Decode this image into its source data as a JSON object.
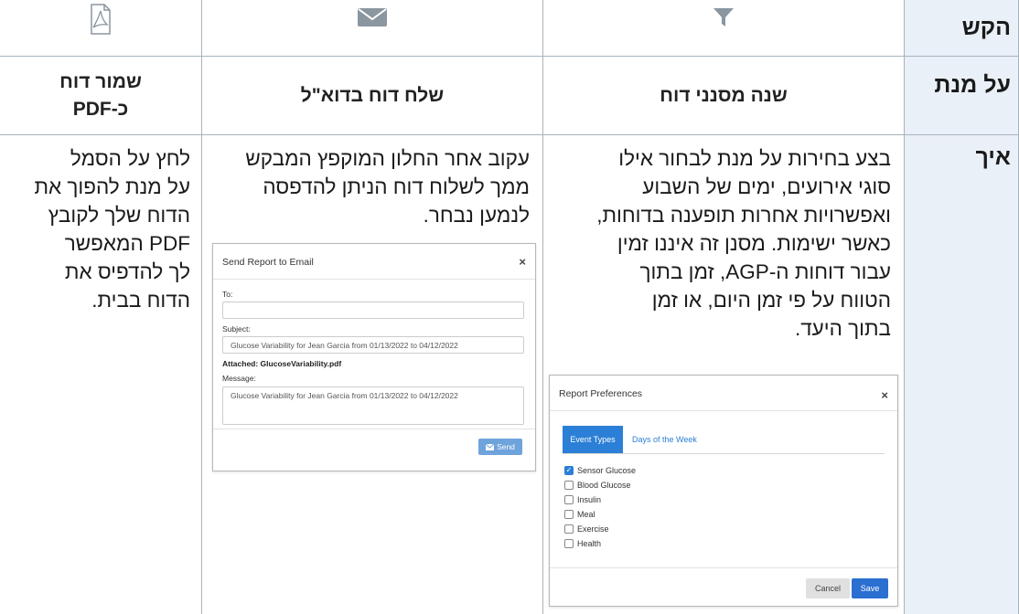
{
  "row_headers": {
    "request": "הקש",
    "purpose": "על מנת",
    "how": "איך"
  },
  "icons": {
    "filter": "filter-icon",
    "email": "envelope-icon",
    "pdf": "pdf-icon"
  },
  "purposes": {
    "filter": "שנה מסנני דוח",
    "email": "שלח דוח בדוא\"ל",
    "pdf_line1": "שמור דוח",
    "pdf_line2": "כ-PDF"
  },
  "how": {
    "filter_lines": [
      "בצע בחירות על מנת לבחור אילו",
      "סוגי אירועים, ימים של השבוע",
      "ואפשרויות אחרות תופענה בדוחות,",
      "כאשר ישימות. מסנן זה איננו זמין",
      "עבור דוחות ה-AGP, זמן בתוך",
      "הטווח על פי זמן היום, או זמן",
      "בתוך היעד."
    ],
    "email_lines": [
      "עקוב אחר החלון המוקפץ המבקש",
      "ממך לשלוח דוח הניתן להדפסה",
      "לנמען נבחר."
    ],
    "pdf_lines": [
      "לחץ על הסמל",
      "על מנת להפוך את",
      "הדוח שלך לקובץ",
      "PDF המאפשר",
      "לך להדפיס את",
      "הדוח בבית."
    ]
  },
  "email_dialog": {
    "title": "Send Report to Email",
    "close": "×",
    "to_label": "To:",
    "to_value": "",
    "subject_label": "Subject:",
    "subject_value": "Glucose Variability for Jean Garcia from 01/13/2022 to 04/12/2022",
    "attached": "Attached: GlucoseVariability.pdf",
    "message_label": "Message:",
    "message_value": "Glucose Variability for Jean Garcia from 01/13/2022 to 04/12/2022",
    "send_label": "Send"
  },
  "prefs_dialog": {
    "title": "Report Preferences",
    "close": "×",
    "tabs": [
      "Event Types",
      "Days of the Week"
    ],
    "options": [
      {
        "label": "Sensor Glucose",
        "checked": true
      },
      {
        "label": "Blood Glucose",
        "checked": false
      },
      {
        "label": "Insulin",
        "checked": false
      },
      {
        "label": "Meal",
        "checked": false
      },
      {
        "label": "Exercise",
        "checked": false
      },
      {
        "label": "Health",
        "checked": false
      }
    ],
    "cancel_label": "Cancel",
    "save_label": "Save"
  },
  "colors": {
    "header_bg": "#eaf0f8",
    "icon": "#8a96a0",
    "border": "#a8b3bc",
    "accent": "#2b7fd6"
  }
}
